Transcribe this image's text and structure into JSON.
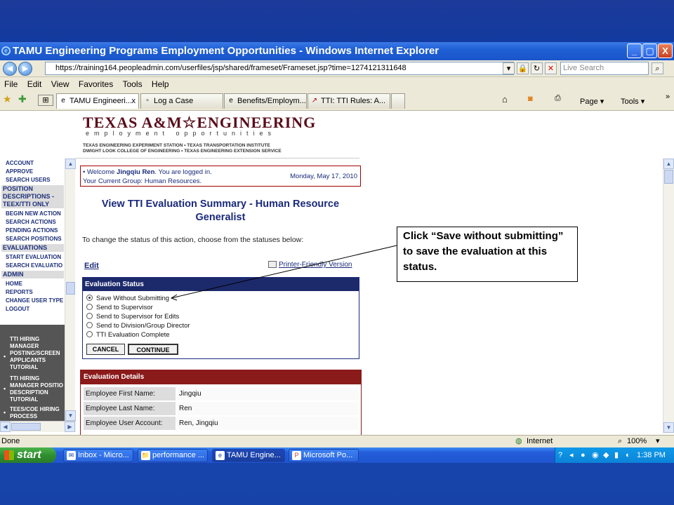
{
  "window": {
    "title": "TAMU Engineering Programs Employment Opportunities - Windows Internet Explorer",
    "minimize": "_",
    "maximize": "▢",
    "close": "X"
  },
  "address": {
    "url": "https://training164.peopleadmin.com/userfiles/jsp/shared/frameset/Frameset.jsp?time=1274121311648",
    "search_placeholder": "Live Search"
  },
  "menu": [
    "File",
    "Edit",
    "View",
    "Favorites",
    "Tools",
    "Help"
  ],
  "tabs": [
    {
      "label": "TAMU Engineeri...",
      "active": true,
      "close": "x"
    },
    {
      "label": "Log a Case",
      "active": false
    },
    {
      "label": "Benefits/Employm...",
      "active": false
    },
    {
      "label": "TTI: TTI Rules: A...",
      "active": false
    }
  ],
  "toolbar": {
    "page": "Page ▾",
    "tools": "Tools ▾",
    "more": "»"
  },
  "banner": {
    "title": "TEXAS A&M☆ENGINEERING",
    "subtitle": "employment opportunities",
    "line1": "TEXAS ENGINEERING EXPERIMENT STATION • TEXAS TRANSPORTATION INSTITUTE",
    "line2": "DWIGHT LOOK COLLEGE OF ENGINEERING • TEXAS ENGINEERING EXTENSION SERVICE"
  },
  "sidebar": {
    "account": [
      "ACCOUNT",
      "APPROVE",
      "SEARCH USERS"
    ],
    "position_head": "POSITION DESCRIPTIONS - TEEX/TTI ONLY",
    "position": [
      "BEGIN NEW ACTION",
      "SEARCH ACTIONS",
      "PENDING ACTIONS",
      "SEARCH POSITIONS"
    ],
    "evaluations_head": "EVALUATIONS",
    "evaluations": [
      "START EVALUATION",
      "SEARCH EVALUATIO"
    ],
    "admin_head": "ADMIN",
    "admin": [
      "HOME",
      "REPORTS",
      "CHANGE USER TYPE",
      "LOGOUT"
    ],
    "tutorials": [
      "TTI HIRING MANAGER POSTING/SCREEN APPLICANTS TUTORIAL",
      "TTI HIRING MANAGER POSITIO DESCRIPTION TUTORIAL",
      "TEES/COE HIRING PROCESS"
    ]
  },
  "welcome": {
    "line1_prefix": "• Welcome ",
    "user": "Jingqiu Ren",
    "line1_suffix": ". You are logged in.",
    "line2": "Your Current Group: Human Resources.",
    "date": "Monday, May 17, 2010"
  },
  "page": {
    "title": "View TTI Evaluation Summary - Human Resource Generalist",
    "instruction": "To change the status of this action, choose from the statuses below:",
    "edit": "Edit",
    "printer": "Printer-Friendly Version"
  },
  "status": {
    "header": "Evaluation Status",
    "options": [
      "Save Without Submitting",
      "Send to Supervisor",
      "Send to Supervisor for Edits",
      "Send to Division/Group Director",
      "TTI Evaluation Complete"
    ],
    "cancel": "CANCEL",
    "continue": "CONTINUE"
  },
  "details": {
    "header": "Evaluation Details",
    "rows": [
      {
        "label": "Employee First Name:",
        "value": "Jingqiu"
      },
      {
        "label": "Employee Last Name:",
        "value": "Ren"
      },
      {
        "label": "Employee User Account:",
        "value": "Ren, Jingqiu"
      }
    ]
  },
  "callout": "Click “Save without submitting” to save the evaluation at this status.",
  "statusbar": {
    "left": "Done",
    "zone": "Internet",
    "zoom": "100%"
  },
  "taskbar": {
    "start": "start",
    "tasks": [
      {
        "label": "Inbox - Micro...",
        "icon": "✉"
      },
      {
        "label": "performance ...",
        "icon": "📁"
      },
      {
        "label": "TAMU Engine...",
        "icon": "e"
      },
      {
        "label": "Microsoft Po...",
        "icon": "P"
      }
    ],
    "time": "1:38 PM"
  },
  "colors": {
    "maroon": "#8b1a1a",
    "navy": "#1c2a6b",
    "xp_blue": "#245edb"
  }
}
